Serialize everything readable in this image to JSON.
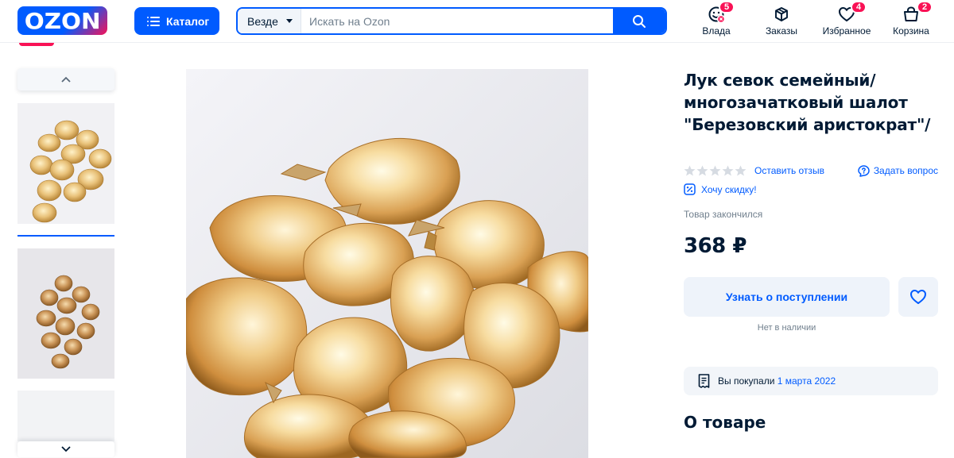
{
  "header": {
    "logo_text": "OZON",
    "catalog_label": "Каталог",
    "search": {
      "scope": "Везде",
      "placeholder": "Искать на Ozon"
    },
    "nav": [
      {
        "label": "Влада",
        "icon": "profile-icon",
        "badge": "5"
      },
      {
        "label": "Заказы",
        "icon": "orders-box-icon",
        "badge": ""
      },
      {
        "label": "Избранное",
        "icon": "heart-icon",
        "badge": "4"
      },
      {
        "label": "Корзина",
        "icon": "cart-bag-icon",
        "badge": "2"
      }
    ]
  },
  "product": {
    "title": "Лук севок семейный/ многозачатковый шалот \"Березовский аристократ\"/",
    "rating_stars": 0,
    "review_link": "Оставить отзыв",
    "ask_link": "Задать вопрос",
    "discount_link": "Хочу скидку!",
    "stock_status": "Товар закончился",
    "price": "368 ₽",
    "notify_button": "Узнать о поступлении",
    "availability_note": "Нет в наличии",
    "purchase_info": {
      "prefix": "Вы покупали",
      "date": "1 марта 2022"
    },
    "about_heading": "О товаре"
  },
  "gallery": {
    "thumbnail_count": 3,
    "selected_index": 0
  },
  "colors": {
    "brand_blue": "#005bff",
    "brand_pink": "#f91155",
    "text_dark": "#001a34",
    "text_muted": "#707f8d"
  }
}
